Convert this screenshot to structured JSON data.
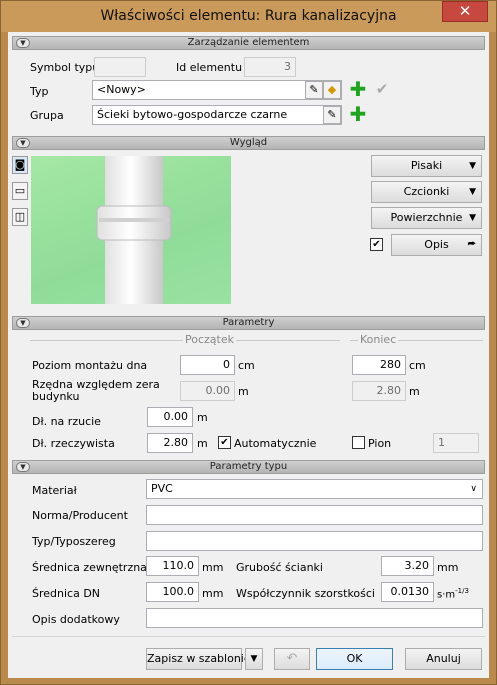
{
  "window": {
    "title": "Właściwości elementu: Rura kanalizacyjna",
    "close": "✕"
  },
  "sections": {
    "zarzadzanie": "Zarządzanie elementem",
    "wyglad": "Wygląd",
    "parametry": "Parametry",
    "parametry_typu": "Parametry typu"
  },
  "zarzadzanie": {
    "symbol_typu_label": "Symbol typu",
    "symbol_typu_value": "",
    "id_label": "Id elementu",
    "id_value": "3",
    "typ_label": "Typ",
    "typ_value": "<Nowy>",
    "grupa_label": "Grupa",
    "grupa_value": "Ścieki bytowo-gospodarcze czarne"
  },
  "wyglad": {
    "pisaki": "Pisaki",
    "czcionki": "Czcionki",
    "powierzchnie": "Powierzchnie",
    "opis": "Opis",
    "opis_checked": true
  },
  "parametry": {
    "header_start": "Początek",
    "header_end": "Koniec",
    "poziom_label": "Poziom montażu dna",
    "poziom_start": "0",
    "poziom_end": "280",
    "poziom_unit": "cm",
    "rzedna_label": "Rzędna względem zera budynku",
    "rzedna_start": "0.00",
    "rzedna_end": "2.80",
    "rzedna_unit": "m",
    "dl_rzut_label": "Dł. na rzucie",
    "dl_rzut_value": "0.00",
    "dl_rzut_unit": "m",
    "dl_rzecz_label": "Dł. rzeczywista",
    "dl_rzecz_value": "2.80",
    "dl_rzecz_unit": "m",
    "automatycznie": "Automatycznie",
    "automatycznie_checked": true,
    "pion": "Pion",
    "pion_checked": false,
    "pion_value": "1"
  },
  "parametry_typu": {
    "material_label": "Materiał",
    "material_value": "PVC",
    "norma_label": "Norma/Producent",
    "norma_value": "",
    "typ_label": "Typ/Typoszereg",
    "typ_value": "",
    "srednica_zew_label": "Średnica zewnętrzna",
    "srednica_zew_value": "110.0",
    "srednica_zew_unit": "mm",
    "grubosc_label": "Grubość ścianki",
    "grubosc_value": "3.20",
    "grubosc_unit": "mm",
    "srednica_dn_label": "Średnica DN",
    "srednica_dn_value": "100.0",
    "srednica_dn_unit": "mm",
    "wspolczynnik_label": "Współczynnik szorstkości",
    "wspolczynnik_value": "0.0130",
    "wspolczynnik_unit": "s·m",
    "wspolczynnik_exp": "-1/3",
    "opis_label": "Opis dodatkowy",
    "opis_value": ""
  },
  "footer": {
    "zapisz": "Zapisz w szablonie",
    "ok": "OK",
    "anuluj": "Anuluj"
  }
}
